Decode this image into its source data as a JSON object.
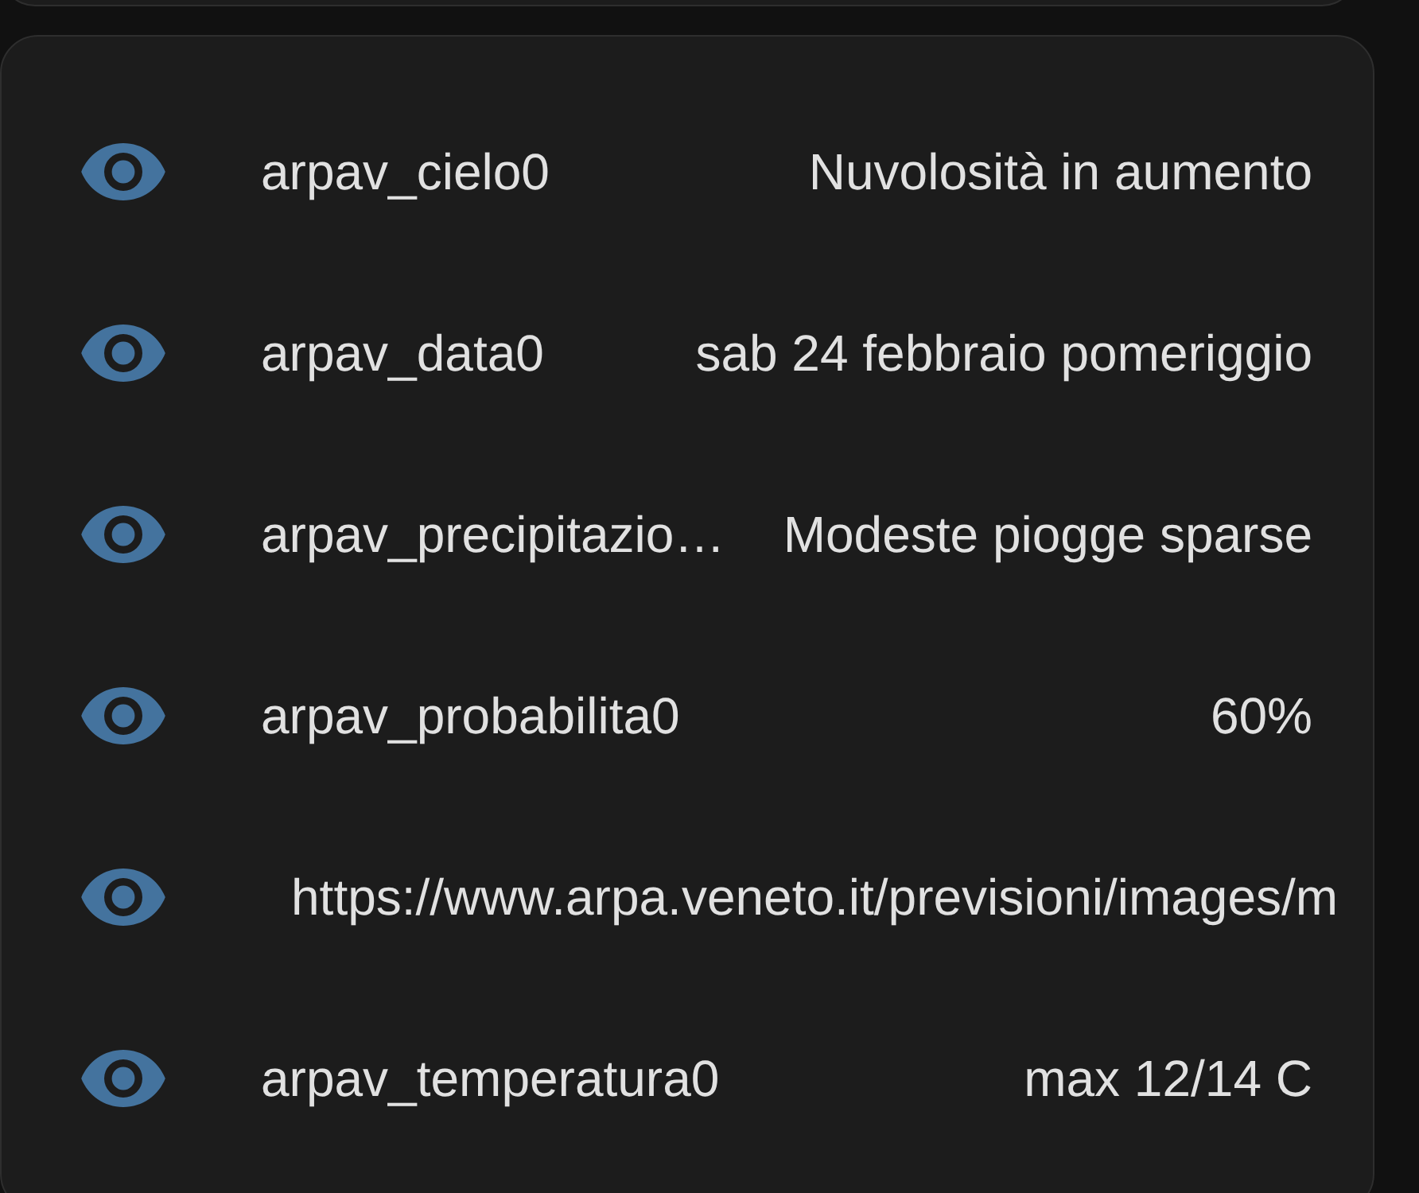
{
  "rows": [
    {
      "kind": "entity",
      "name": "arpav_cielo0",
      "value": "Nuvolosità in aumento"
    },
    {
      "kind": "entity",
      "name": "arpav_data0",
      "value": "sab 24 febbraio pomeriggio"
    },
    {
      "kind": "entity",
      "name": "arpav_precipitazio…",
      "value": "Modeste piogge sparse"
    },
    {
      "kind": "entity",
      "name": "arpav_probabilita0",
      "value": "60%"
    },
    {
      "kind": "long_state",
      "value": "https://www.arpa.veneto.it/previsioni/images/m"
    },
    {
      "kind": "entity",
      "name": "arpav_temperatura0",
      "value": "max 12/14 C"
    }
  ]
}
